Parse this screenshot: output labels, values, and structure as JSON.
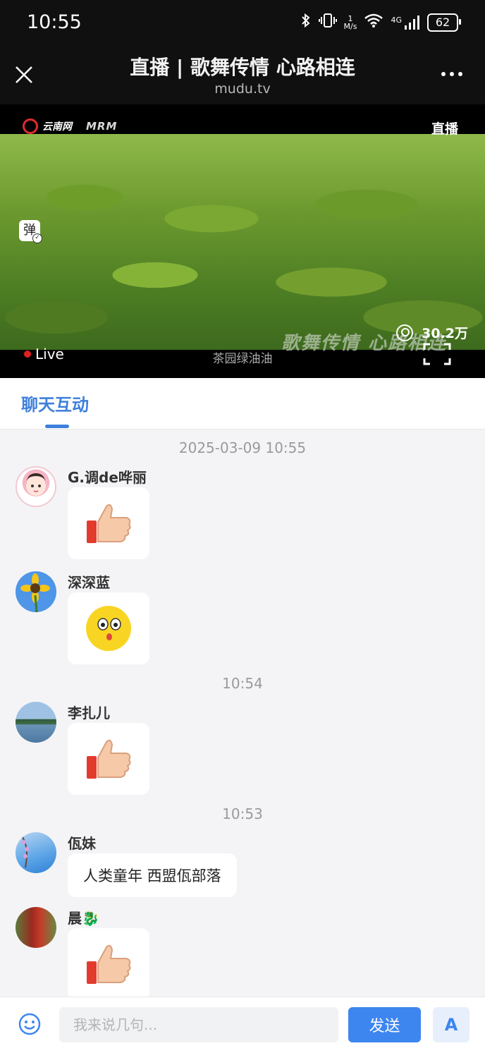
{
  "status_bar": {
    "time": "10:55",
    "net_speed_value": "1",
    "net_speed_unit": "M/s",
    "network": "4G",
    "battery": "62"
  },
  "header": {
    "title": "直播 | 歌舞传情 心路相连",
    "domain": "mudu.tv"
  },
  "video": {
    "logo_text": "云南网",
    "logo_sub": "MRM",
    "live_badge": "直播",
    "danmu_label": "弹",
    "viewers": "30.2万",
    "live_label": "Live",
    "subtitle": "茶园绿油油",
    "overlay_title": "歌舞传情 心路相连"
  },
  "tabs": [
    {
      "label": "聊天互动",
      "active": true
    }
  ],
  "chat": {
    "timestamps": [
      "2025-03-09 10:55",
      "10:54",
      "10:53"
    ],
    "messages": [
      {
        "user": "G.调de哗丽",
        "type": "sticker",
        "sticker": "thumbs-up"
      },
      {
        "user": "深深蓝",
        "type": "sticker",
        "sticker": "surprised-face"
      },
      {
        "user": "李扎儿",
        "type": "sticker",
        "sticker": "thumbs-up"
      },
      {
        "user": "佤妹",
        "type": "text",
        "text": "人类童年 西盟佤部落"
      },
      {
        "user": "晨🐉",
        "type": "sticker",
        "sticker": "thumbs-up"
      }
    ]
  },
  "composer": {
    "placeholder": "我来说几句...",
    "send_label": "发送",
    "font_button": "A"
  },
  "colors": {
    "accent": "#3e86ef",
    "tab_active": "#3e7fdc",
    "live_dot": "#e02020",
    "bar_bg": "#101010"
  }
}
